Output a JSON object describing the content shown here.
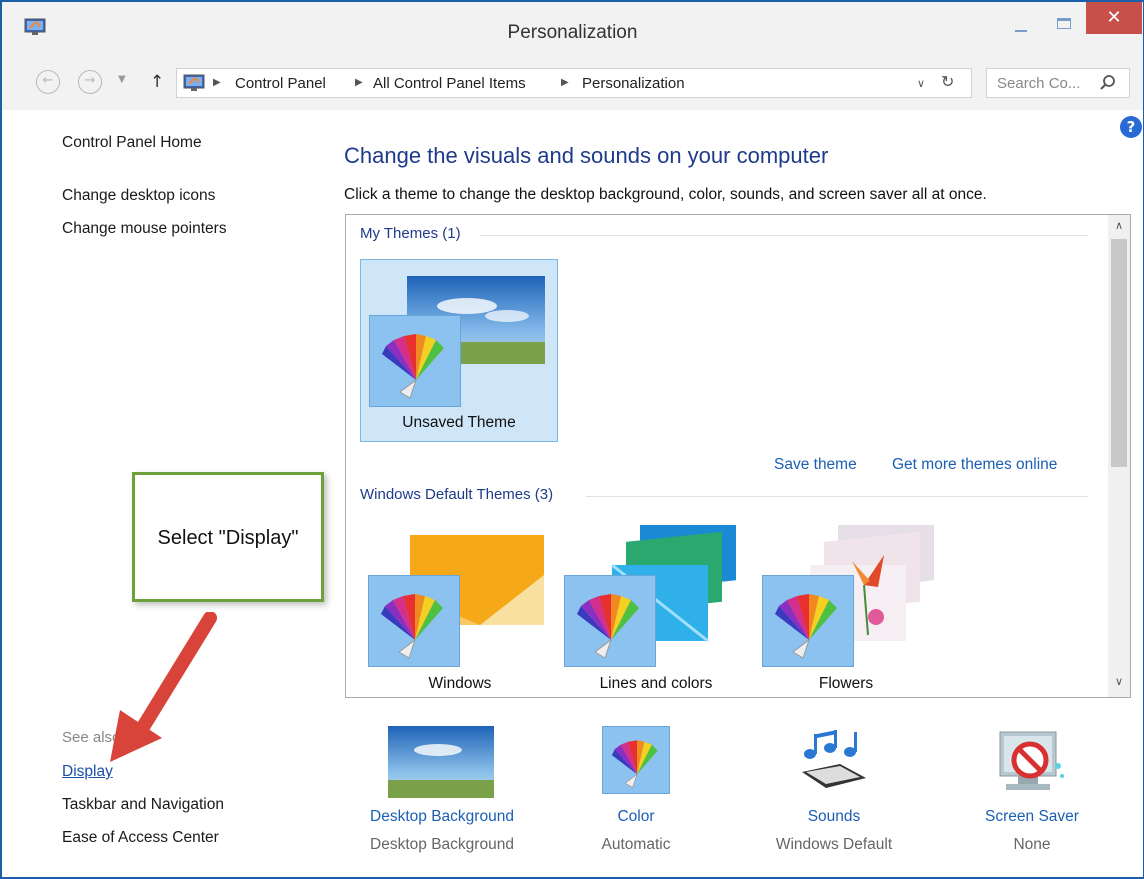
{
  "window": {
    "title": "Personalization",
    "close_glyph": "✕"
  },
  "address_bar": {
    "breadcrumbs": [
      "Control Panel",
      "All Control Panel Items",
      "Personalization"
    ],
    "search_placeholder": "Search Co..."
  },
  "left_pane": {
    "home": "Control Panel Home",
    "links": [
      "Change desktop icons",
      "Change mouse pointers"
    ],
    "see_also_label": "See also",
    "see_also_links": [
      "Display",
      "Taskbar and Navigation",
      "Ease of Access Center"
    ]
  },
  "main": {
    "heading": "Change the visuals and sounds on your computer",
    "subtitle": "Click a theme to change the desktop background, color, sounds, and screen saver all at once.",
    "my_themes_header": "My Themes (1)",
    "my_themes": [
      {
        "name": "Unsaved Theme",
        "selected": true
      }
    ],
    "save_theme": "Save theme",
    "get_more_themes": "Get more themes online",
    "default_themes_header": "Windows Default Themes (3)",
    "default_themes": [
      {
        "name": "Windows"
      },
      {
        "name": "Lines and colors"
      },
      {
        "name": "Flowers"
      }
    ]
  },
  "settings": [
    {
      "label": "Desktop Background",
      "value": "Desktop Background",
      "icon": "desktop-background-icon"
    },
    {
      "label": "Color",
      "value": "Automatic",
      "icon": "color-icon"
    },
    {
      "label": "Sounds",
      "value": "Windows Default",
      "icon": "sounds-icon"
    },
    {
      "label": "Screen Saver",
      "value": "None",
      "icon": "screen-saver-icon"
    }
  ],
  "callout": {
    "text": "Select \"Display\""
  },
  "colors": {
    "link_blue": "#1a5fb4",
    "heading_blue": "#1e3a8a",
    "selection_bg": "#cfe6f8",
    "callout_border": "#6ba03a",
    "arrow_red": "#d9443a",
    "close_red": "#c7504b"
  }
}
